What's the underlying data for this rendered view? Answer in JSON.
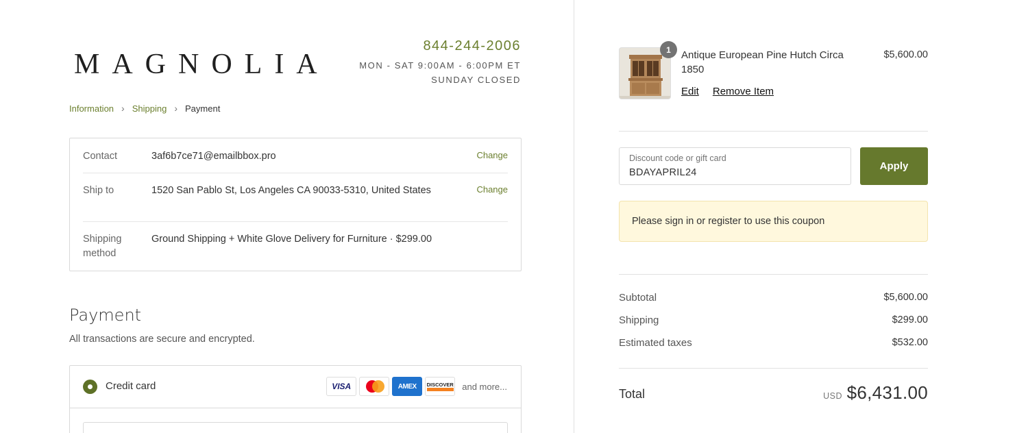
{
  "brand": {
    "logo": "MAGNOLIA"
  },
  "header": {
    "phone": "844-244-2006",
    "hours": "MON - SAT 9:00AM - 6:00PM ET",
    "closed": "SUNDAY CLOSED"
  },
  "breadcrumb": {
    "items": [
      "Information",
      "Shipping",
      "Payment"
    ],
    "separator": "›"
  },
  "review": {
    "contact": {
      "label": "Contact",
      "value": "3af6b7ce71@emailbbox.pro",
      "action": "Change"
    },
    "ship_to": {
      "label": "Ship to",
      "value": "1520 San Pablo St, Los Angeles CA 90033-5310, United States",
      "action": "Change"
    },
    "shipping_method": {
      "label": "Shipping method",
      "value": "Ground Shipping + White Glove Delivery for Furniture · $299.00"
    }
  },
  "payment": {
    "title": "Payment",
    "subtitle": "All transactions are secure and encrypted.",
    "method_label": "Credit card",
    "cards": {
      "visa": "VISA",
      "amex": "AMEX",
      "discover": "DISCOVER"
    },
    "more": "and more..."
  },
  "cart": {
    "item": {
      "quantity": "1",
      "name": "Antique European Pine Hutch Circa 1850",
      "price": "$5,600.00",
      "edit": "Edit",
      "remove": "Remove Item"
    },
    "discount": {
      "label": "Discount code or gift card",
      "value": "BDAYAPRIL24",
      "apply": "Apply",
      "notice": "Please sign in or register to use this coupon"
    },
    "summary": {
      "subtotal_label": "Subtotal",
      "subtotal": "$5,600.00",
      "shipping_label": "Shipping",
      "shipping": "$299.00",
      "taxes_label": "Estimated taxes",
      "taxes": "$532.00",
      "total_label": "Total",
      "currency": "USD",
      "total": "$6,431.00"
    }
  },
  "colors": {
    "accent": "#66792d",
    "link": "#6b7f2e",
    "notice_bg": "#fff8dd"
  }
}
